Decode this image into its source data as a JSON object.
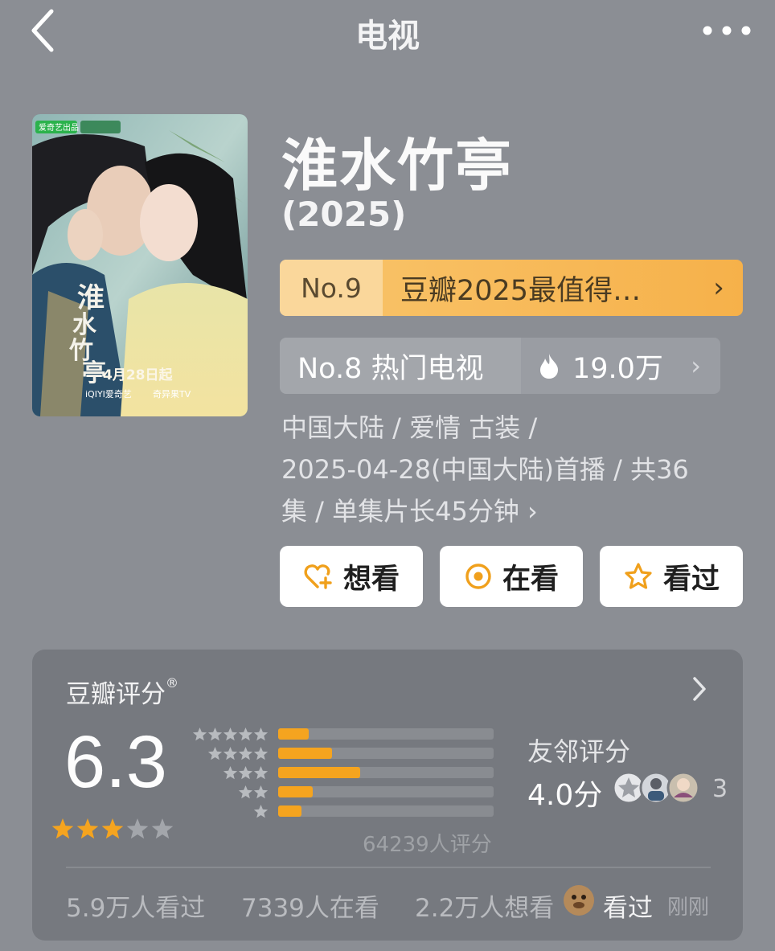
{
  "nav": {
    "title": "电视",
    "back_icon": "back-chevron-icon",
    "more_icon": "more-dots-icon"
  },
  "poster": {
    "overlay_title": "淮水竹亭",
    "date_text": "4月28日起",
    "badge": "爱奇艺出品",
    "platform": "iQIYI爱奇艺",
    "platform2": "奇异果TV"
  },
  "show": {
    "title": "淮水竹亭",
    "year": "(2025)"
  },
  "rank_primary": {
    "no": "No.9",
    "label": "豆瓣2025最值得…",
    "chevron": "›"
  },
  "rank_secondary": {
    "label": "No.8 热门电视",
    "heat": "19.0万",
    "chevron": "›",
    "icon": "flame-icon"
  },
  "meta": {
    "line1": "中国大陆 / 爱情 古装 /",
    "line2": "2025-04-28(中国大陆)首播 / 共36",
    "line3": "集 / 单集片长45分钟",
    "chevron": "›"
  },
  "actions": {
    "want": "想看",
    "watching": "在看",
    "watched": "看过"
  },
  "rating": {
    "header": "豆瓣评分",
    "registered": "®",
    "score": "6.3",
    "stars_filled": 3,
    "stars_total": 5,
    "distribution_percent": [
      14,
      25,
      38,
      16,
      11
    ],
    "count_text": "64239人评分",
    "friend_label": "友邻评分",
    "friend_score": "4.0分",
    "friend_count": "3",
    "accent": "#f5a41f"
  },
  "stats": {
    "watched": "5.9万人看过",
    "watching": "7339人在看",
    "want": "2.2万人想看",
    "friend_action": "看过",
    "friend_time": "刚刚"
  }
}
